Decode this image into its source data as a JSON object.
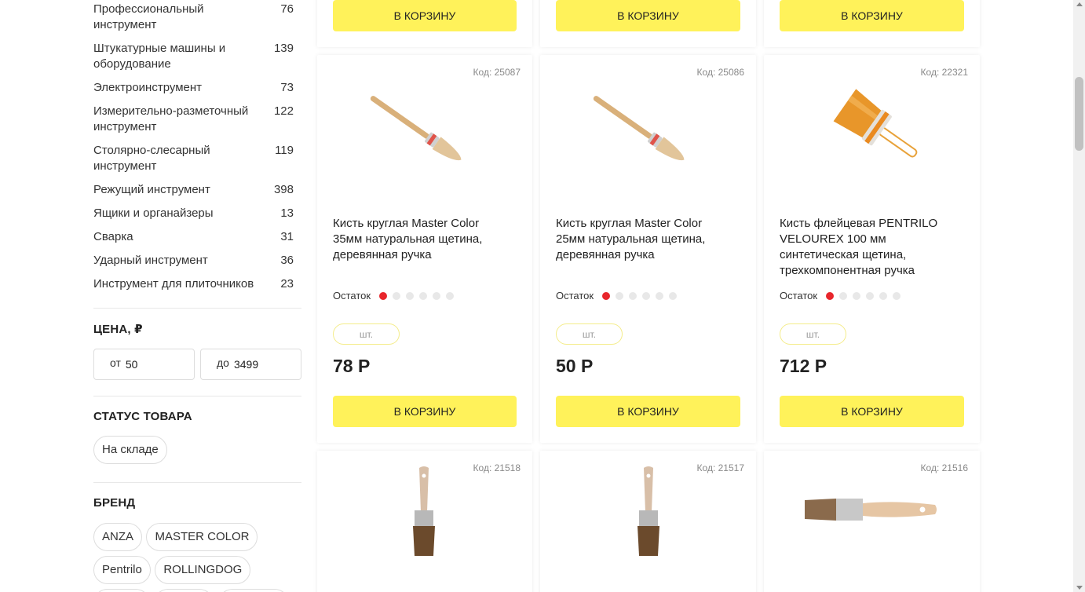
{
  "categories": [
    {
      "name": "Профессиональный инструмент",
      "count": "76"
    },
    {
      "name": "Штукатурные машины и оборудование",
      "count": "139"
    },
    {
      "name": "Электроинструмент",
      "count": "73"
    },
    {
      "name": "Измерительно-разметочный инструмент",
      "count": "122"
    },
    {
      "name": "Столярно-слесарный инструмент",
      "count": "119"
    },
    {
      "name": "Режущий инструмент",
      "count": "398"
    },
    {
      "name": "Ящики и органайзеры",
      "count": "13"
    },
    {
      "name": "Сварка",
      "count": "31"
    },
    {
      "name": "Ударный инструмент",
      "count": "36"
    },
    {
      "name": "Инструмент для плиточников",
      "count": "23"
    }
  ],
  "price_filter": {
    "title": "ЦЕНА, ₽",
    "from_label": "от",
    "from_value": "50",
    "to_label": "до",
    "to_value": "3499"
  },
  "status_filter": {
    "title": "СТАТУС ТОВАРА",
    "options": [
      "На складе"
    ]
  },
  "brand_filter": {
    "title": "БРЕНД",
    "options": [
      "ANZA",
      "MASTER COLOR",
      "Pentrilo",
      "ROLLINGDOG"
    ]
  },
  "cart_button_label": "В КОРЗИНУ",
  "stock_label": "Остаток",
  "unit_label": "шт.",
  "products": [
    {
      "code": "Код: 25087",
      "title": "Кисть круглая Master Color 35мм натуральная щетина, деревянная ручка",
      "price": "78 Р",
      "stock_level": 1
    },
    {
      "code": "Код: 25086",
      "title": "Кисть круглая Master Color 25мм натуральная щетина, деревянная ручка",
      "price": "50 Р",
      "stock_level": 1
    },
    {
      "code": "Код: 22321",
      "title": "Кисть флейцевая PENTRILO VELOUREX 100 мм синтетическая щетина, трехкомпонентная ручка",
      "price": "712 Р",
      "stock_level": 1
    }
  ],
  "products_row3": [
    {
      "code": "Код: 21518"
    },
    {
      "code": "Код: 21517"
    },
    {
      "code": "Код: 21516"
    }
  ],
  "colors": {
    "accent_yellow": "#fff25a",
    "stock_red": "#e8262c"
  }
}
